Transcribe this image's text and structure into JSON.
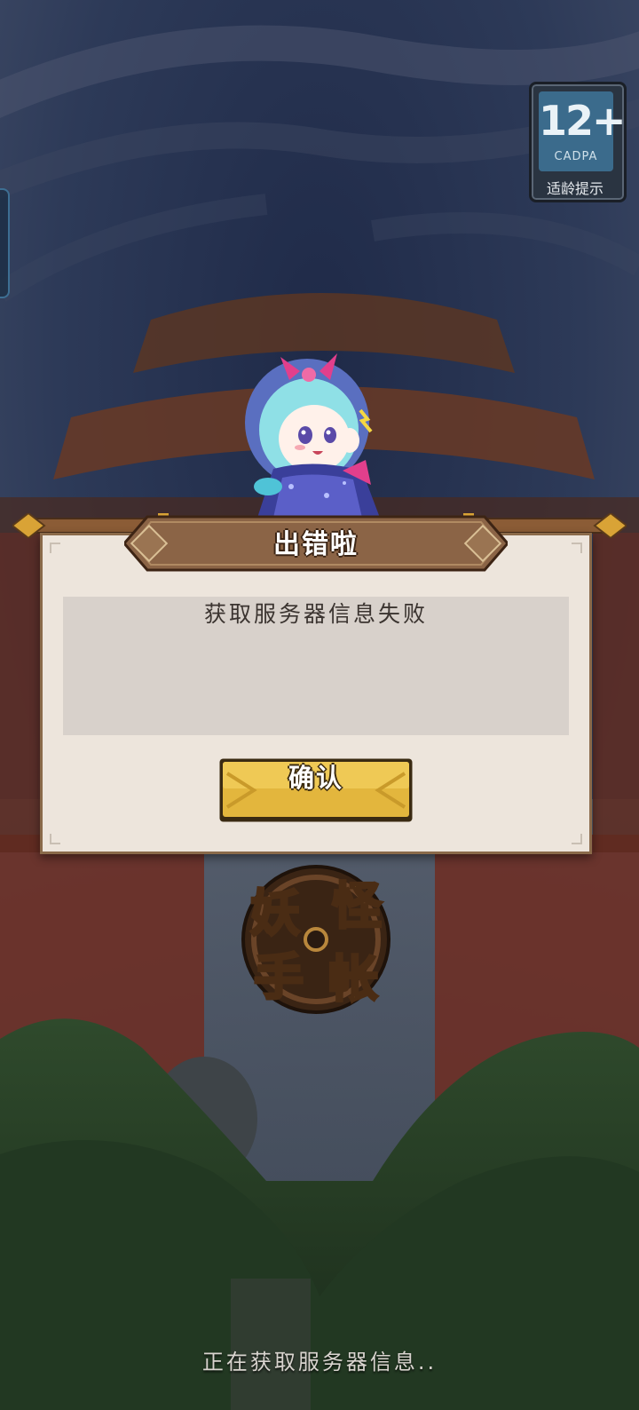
{
  "age_rating": {
    "number": "12+",
    "org": "CADPA",
    "hint": "适龄提示"
  },
  "dialog": {
    "title": "出错啦",
    "message": "获取服务器信息失败",
    "confirm_label": "确认"
  },
  "logo": {
    "text": "妖怪手帐"
  },
  "status": {
    "text": "正在获取服务器信息.."
  },
  "colors": {
    "panel": "#ede5dc",
    "message_box": "#d8d1cb",
    "title_plaque": "#8b6446",
    "button_gold": "#e0b43a",
    "sky": "#2b3550"
  },
  "icons": [
    "character-portrait",
    "game-logo-emblem",
    "cadpa-badge"
  ]
}
